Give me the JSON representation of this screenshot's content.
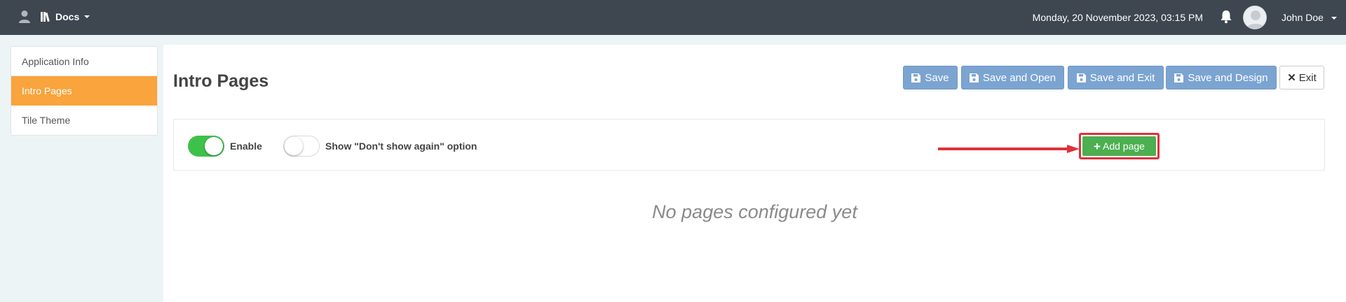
{
  "topbar": {
    "docs_label": "Docs",
    "datetime": "Monday, 20 November 2023, 03:15 PM",
    "username": "John Doe"
  },
  "sidebar": {
    "items": [
      {
        "label": "Application Info",
        "active": false
      },
      {
        "label": "Intro Pages",
        "active": true
      },
      {
        "label": "Tile Theme",
        "active": false
      }
    ]
  },
  "main": {
    "title": "Intro Pages",
    "buttons": {
      "save": "Save",
      "save_open": "Save and Open",
      "save_exit": "Save and Exit",
      "save_design": "Save and Design",
      "exit": "Exit"
    },
    "options": {
      "enable_label": "Enable",
      "enable_on": true,
      "dont_show_label": "Show \"Don't show again\" option",
      "dont_show_on": false
    },
    "add_page_label": "Add page",
    "empty_message": "No pages configured yet"
  },
  "colors": {
    "topbar": "#3e4650",
    "active_tab": "#f9a43c",
    "save_button": "#7ba4d1",
    "add_button": "#4caf50",
    "toggle_on": "#3ec14a",
    "highlight": "#e0313b"
  }
}
